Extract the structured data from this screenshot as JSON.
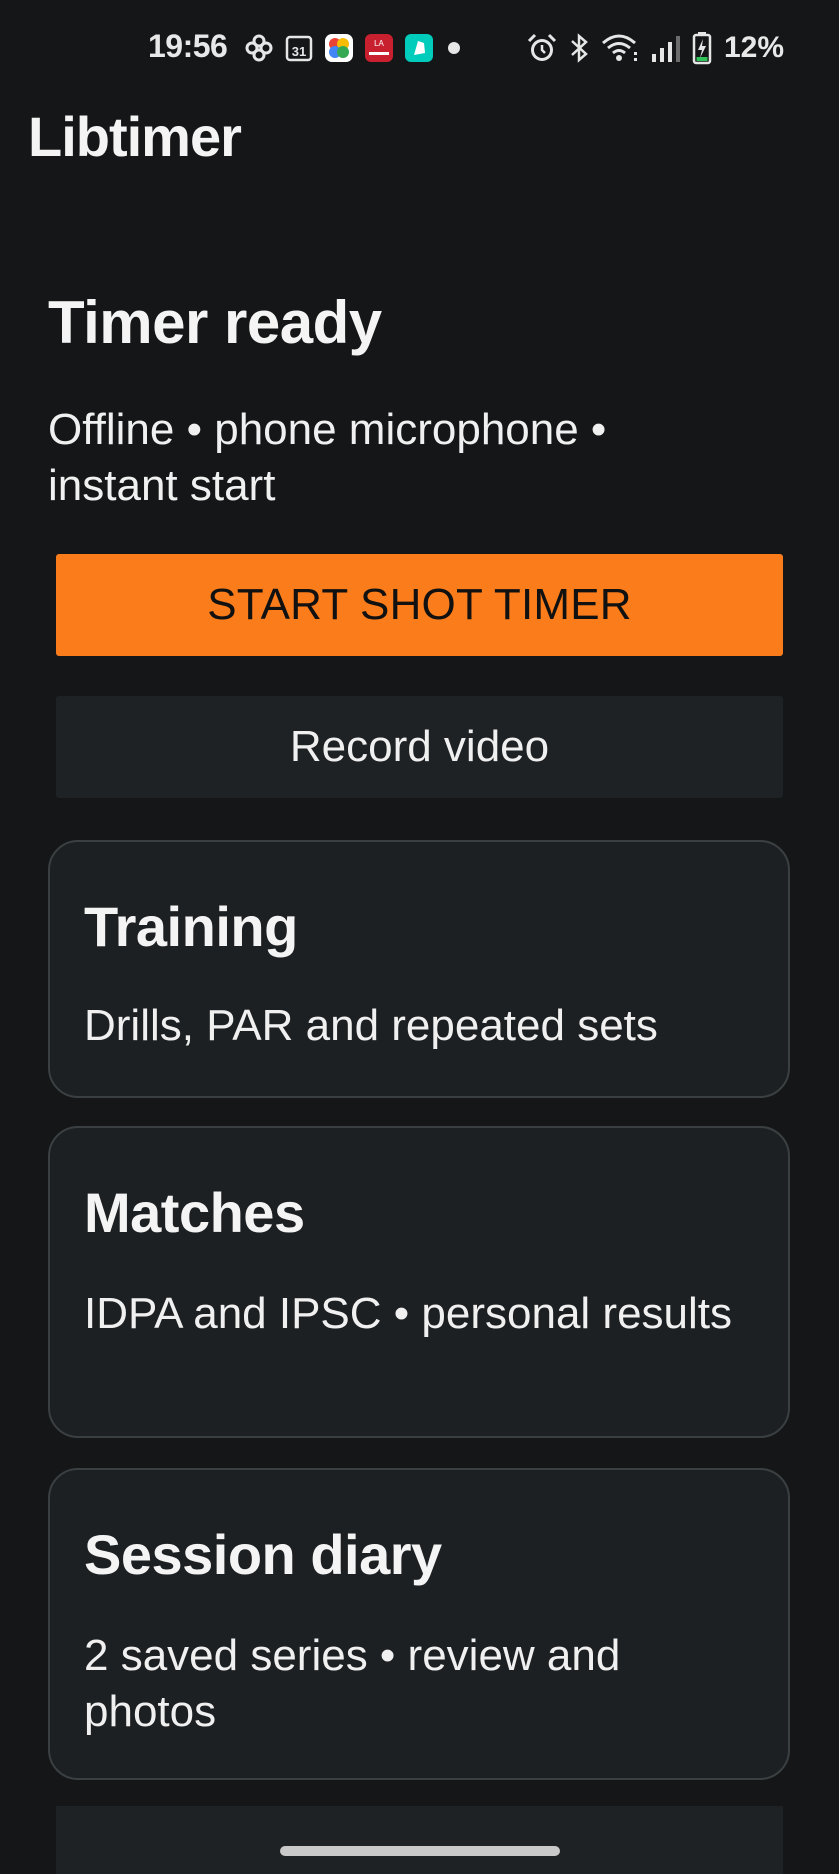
{
  "status_bar": {
    "time": "19:56",
    "battery": "12%",
    "notification_icons": [
      "pinwheel-icon",
      "calendar-icon",
      "photos-icon",
      "la-parisien-icon",
      "deliveroo-icon",
      "more-dot-icon"
    ],
    "calendar_day": "31",
    "news_icon_text": "LA",
    "system_icons": [
      "alarm-icon",
      "bluetooth-icon",
      "wifi-icon",
      "signal-icon",
      "battery-charging-icon"
    ]
  },
  "app": {
    "title": "Libtimer"
  },
  "hero": {
    "title": "Timer ready",
    "subtitle": "Offline • phone microphone • instant start",
    "primary_button": "START SHOT TIMER",
    "secondary_button": "Record video"
  },
  "cards": [
    {
      "title": "Training",
      "text": "Drills, PAR and repeated sets"
    },
    {
      "title": "Matches",
      "text": "IDPA and IPSC • personal results"
    },
    {
      "title": "Session diary",
      "text": "2 saved series • review and photos"
    }
  ],
  "colors": {
    "background": "#141617",
    "accent": "#fb7c1a",
    "card": "#1d2022",
    "card_border": "#3a3f42",
    "battery_charge": "#2ec45a"
  }
}
